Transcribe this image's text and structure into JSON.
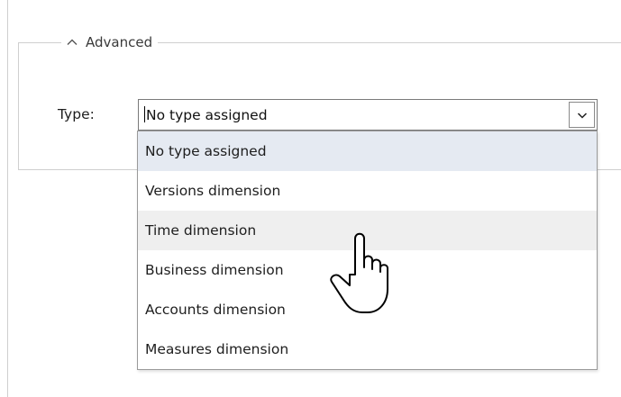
{
  "advanced_group": {
    "legend": "Advanced",
    "toggle_icon": "chevron-up-icon"
  },
  "type_field": {
    "label": "Type:",
    "value": "No type assigned",
    "arrow_icon": "chevron-down-icon"
  },
  "dropdown": {
    "options": [
      {
        "label": "No type assigned",
        "state": "selected"
      },
      {
        "label": "Versions dimension",
        "state": "normal"
      },
      {
        "label": "Time dimension",
        "state": "hovered"
      },
      {
        "label": "Business dimension",
        "state": "normal"
      },
      {
        "label": "Accounts dimension",
        "state": "normal"
      },
      {
        "label": "Measures dimension",
        "state": "normal"
      }
    ]
  },
  "cursor": {
    "icon": "hand-pointer-icon"
  },
  "colors": {
    "selected_option_bg": "#e5eaf2",
    "hovered_option_bg": "#efefef",
    "border": "#cfcfcf"
  }
}
